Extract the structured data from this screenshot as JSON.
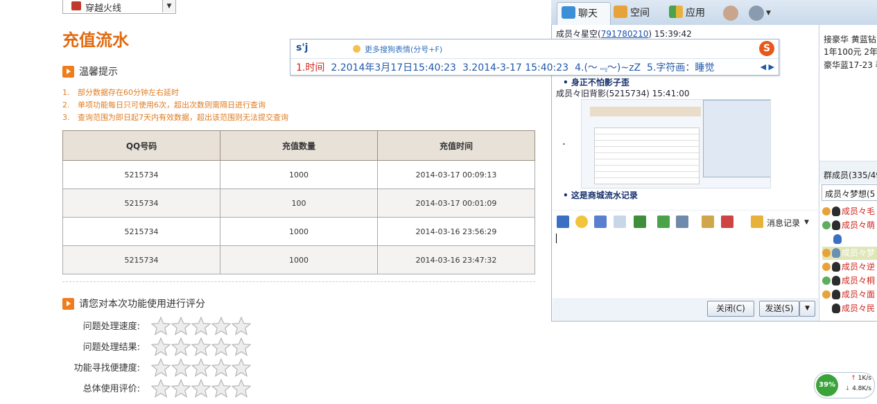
{
  "game_select": {
    "value": "穿越火线",
    "arrow": "▼"
  },
  "page_title": "充值流水",
  "tips": {
    "title": "温馨提示",
    "items": [
      {
        "num": "1.",
        "text": "部分数据存在60分钟左右延时"
      },
      {
        "num": "2.",
        "text": "单项功能每日只可使用6次，超出次数则需隔日进行查询"
      },
      {
        "num": "3.",
        "text": "查询范围为即日起7天内有效数据，超出该范围则无法提交查询"
      }
    ]
  },
  "table": {
    "headers": [
      "QQ号码",
      "充值数量",
      "充值时间"
    ],
    "rows": [
      [
        "5215734",
        "1000",
        "2014-03-17 00:09:13"
      ],
      [
        "5215734",
        "100",
        "2014-03-17 00:01:09"
      ],
      [
        "5215734",
        "1000",
        "2014-03-16 23:56:29"
      ],
      [
        "5215734",
        "1000",
        "2014-03-16 23:47:32"
      ]
    ]
  },
  "rating": {
    "title": "请您对本次功能使用进行评分",
    "items": [
      {
        "label": "问题处理速度:",
        "stars": 0
      },
      {
        "label": "问题处理结果:",
        "stars": 0
      },
      {
        "label": "功能寻找便捷度:",
        "stars": 0
      },
      {
        "label": "总体使用评价:",
        "stars": 0
      }
    ]
  },
  "ime": {
    "composition": "s'j",
    "more_label": "更多搜狗表情(分号+F)",
    "logo": "S",
    "candidates": [
      "1.时间",
      "2.2014年3月17日15:40:23",
      "3.2014-3-17 15:40:23",
      "4.(～﹃～)~zZ",
      "5.字符画：睡觉"
    ],
    "pager": "◀ ▶"
  },
  "qq": {
    "tabs": [
      "聊天",
      "空间",
      "应用"
    ],
    "messages": {
      "m1_sender": "成员々星空(",
      "m1_id": "791780210",
      "m1_time": ")    15:39:42",
      "m1_text": "身正不怕影子歪",
      "m2_sender": "成员々旧背影(5215734)    15:41:00",
      "m2_text": "这是商城流水记录"
    },
    "history_label": "消息记录",
    "close_label": "关闭(C)",
    "send_label": "发送(S)",
    "send_arrow": "▼",
    "side": {
      "notice": [
        "接豪华 黄蓝钻",
        "1年100元 2年",
        "豪华蓝17-23 著"
      ],
      "members_title": "群成员(335/499)",
      "search_value": "成员々梦想(5",
      "members": [
        "成员々毛",
        "成员々萌",
        "成员々梦",
        "成员々梦",
        "成员々逆",
        "成员々桐",
        "成员々面",
        "成员々民"
      ]
    }
  },
  "net_monitor": {
    "percent": "39%",
    "up": "1K/s",
    "down": "4.8K/s"
  },
  "colors": {
    "accent": "#e06a10",
    "tip": "#e07b1f",
    "link": "#1a4fa8",
    "ime_selected": "#d0251d"
  }
}
